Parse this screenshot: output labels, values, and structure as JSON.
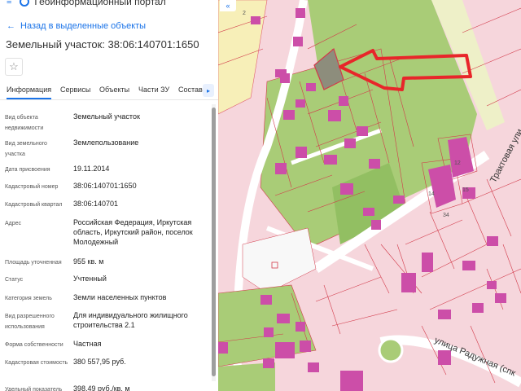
{
  "app": {
    "title": "Геоинформационный портал"
  },
  "nav": {
    "back_label": "Назад в выделенные объекты"
  },
  "object": {
    "title": "Земельный участок: 38:06:140701:1650"
  },
  "tabs": [
    {
      "label": "Информация",
      "active": true
    },
    {
      "label": "Сервисы",
      "active": false
    },
    {
      "label": "Объекты",
      "active": false
    },
    {
      "label": "Части ЗУ",
      "active": false
    },
    {
      "label": "Состав",
      "active": false
    }
  ],
  "properties": [
    {
      "label": "Вид объекта недвижимости",
      "value": "Земельный участок"
    },
    {
      "label": "Вид земельного участка",
      "value": "Землепользование"
    },
    {
      "label": "Дата присвоения",
      "value": "19.11.2014"
    },
    {
      "label": "Кадастровый номер",
      "value": "38:06:140701:1650"
    },
    {
      "label": "Кадастровый квартал",
      "value": "38:06:140701"
    },
    {
      "label": "Адрес",
      "value": "Российская Федерация, Иркутская область, Иркутский район, поселок Молодежный"
    },
    {
      "label": "Площадь уточненная",
      "value": "955 кв. м"
    },
    {
      "label": "Статус",
      "value": "Учтенный"
    },
    {
      "label": "Категория земель",
      "value": "Земли населенных пунктов"
    },
    {
      "label": "Вид разрешенного использования",
      "value": "Для индивидуального жилищного строительства 2.1"
    },
    {
      "label": "Форма собственности",
      "value": "Частная"
    },
    {
      "label": "Кадастровая стоимость",
      "value": "380 557,95 руб."
    },
    {
      "label": "Удельный показатель",
      "value": "398,49 руб./кв. м"
    }
  ],
  "map": {
    "labels": {
      "street_traktovaya": "Трактовая ули",
      "street_raduzhnaya": "улица Радужная (спк",
      "parcel_12": "12",
      "parcel_14": "14",
      "parcel_15": "15",
      "parcel_34": "34",
      "parcel_2": "2"
    },
    "collapse_label": "«"
  },
  "colors": {
    "accent": "#1a73e8",
    "parcel_fill": "#f6d6dc",
    "green": "#a9cc77",
    "building": "#cc4ea8",
    "arrow": "#e8262a",
    "selected": "#8d8d7c"
  }
}
